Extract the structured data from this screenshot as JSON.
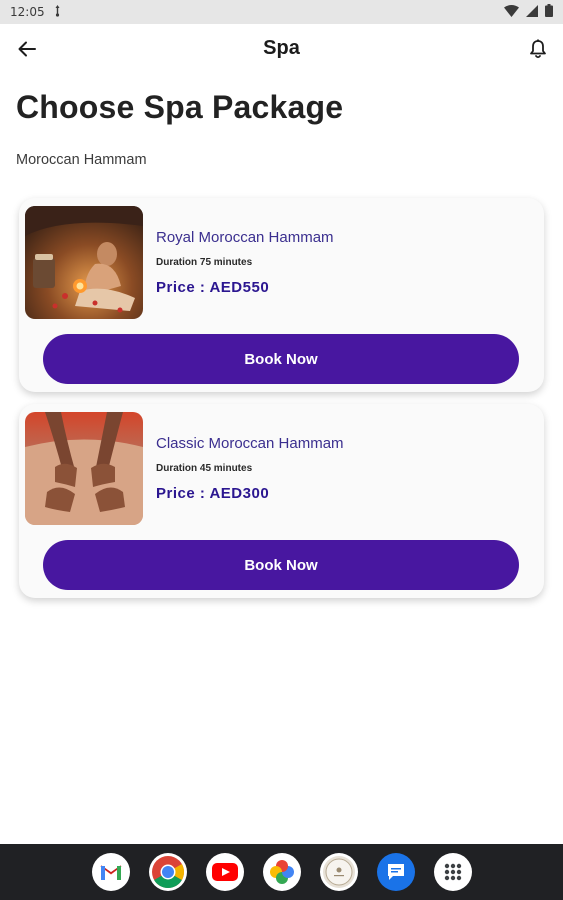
{
  "status_bar": {
    "time": "12:05"
  },
  "app_bar": {
    "title": "Spa"
  },
  "page": {
    "heading": "Choose Spa Package",
    "subheading": "Moroccan Hammam"
  },
  "packages": [
    {
      "name": "Royal Moroccan Hammam",
      "duration": "Duration 75 minutes",
      "price": "Price : AED550",
      "button_label": "Book Now"
    },
    {
      "name": "Classic Moroccan Hammam",
      "duration": "Duration 45 minutes",
      "price": "Price : AED300",
      "button_label": "Book Now"
    }
  ],
  "dock": {
    "apps": [
      "gmail-icon",
      "chrome-icon",
      "youtube-icon",
      "photos-icon",
      "app-icon",
      "messages-icon",
      "app-drawer-icon"
    ]
  },
  "colors": {
    "accent": "#4817a0",
    "price_text": "#2b1690",
    "name_text": "#3b2f8f",
    "card_bg": "#fafafa",
    "dock_bg": "#202124"
  }
}
